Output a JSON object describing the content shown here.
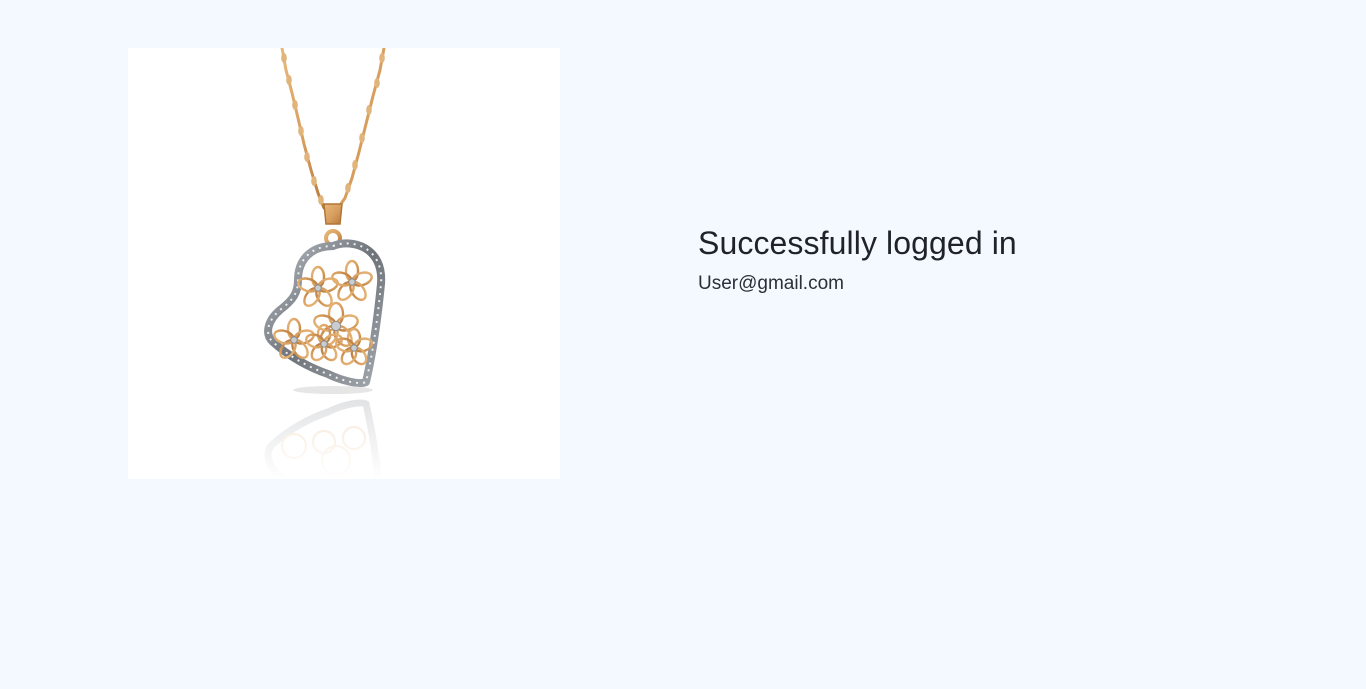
{
  "status": {
    "title": "Successfully logged in",
    "email": "User@gmail.com"
  },
  "product_image": {
    "icon": "heart-pendant-necklace"
  },
  "colors": {
    "background": "#f4f8ff",
    "image_background": "#ffffff",
    "gold": "#d7a061",
    "stone": "#8a8f96"
  }
}
